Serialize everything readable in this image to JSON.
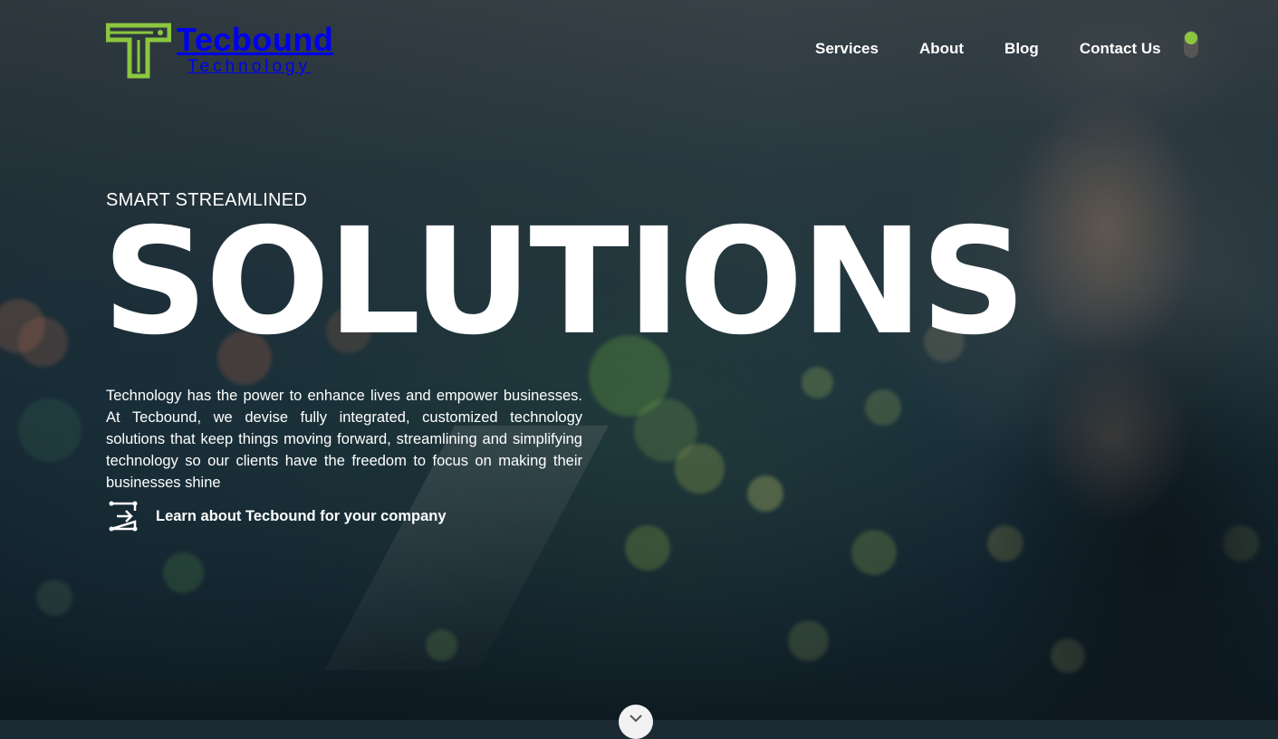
{
  "brand": {
    "name": "Tecbound",
    "tagline": "Technology",
    "accent_color": "#8cc63f"
  },
  "nav": {
    "items": [
      {
        "label": "Services"
      },
      {
        "label": "About"
      },
      {
        "label": "Blog"
      },
      {
        "label": "Contact Us"
      }
    ]
  },
  "hero": {
    "eyebrow": "SMART STREAMLINED",
    "headline": "SOLUTIONS",
    "body": "Technology has the power to enhance lives and empower businesses. At Tecbound, we devise fully integrated, customized technology solutions that keep things moving forward, streamlining and simplifying technology so our clients have the freedom to focus on making their businesses shine",
    "cta_label": "Learn about Tecbound for your company",
    "cta_icon": "arrow-right-in-box-icon"
  },
  "scroll_button_icon": "chevron-down-icon"
}
